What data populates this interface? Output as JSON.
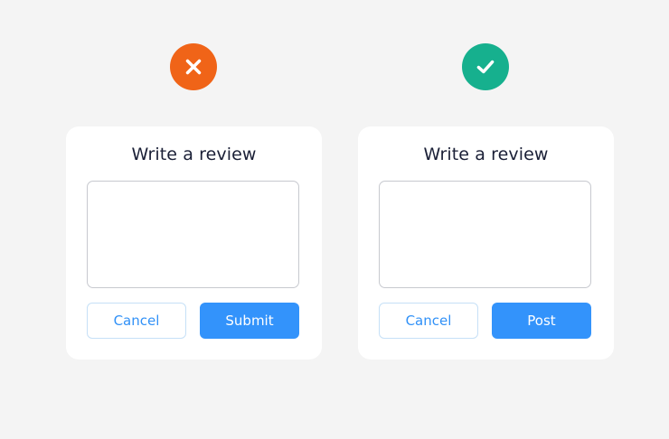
{
  "colors": {
    "background": "#f4f4f4",
    "bad_badge": "#f06418",
    "good_badge": "#16b08e",
    "primary": "#3393fb",
    "cancel_text": "#3191f7",
    "title_text": "#1a1f36"
  },
  "bad_example": {
    "badge_icon": "close-icon",
    "title": "Write a review",
    "textarea_value": "",
    "cancel_label": "Cancel",
    "primary_label": "Submit"
  },
  "good_example": {
    "badge_icon": "check-icon",
    "title": "Write a review",
    "textarea_value": "",
    "cancel_label": "Cancel",
    "primary_label": "Post"
  }
}
